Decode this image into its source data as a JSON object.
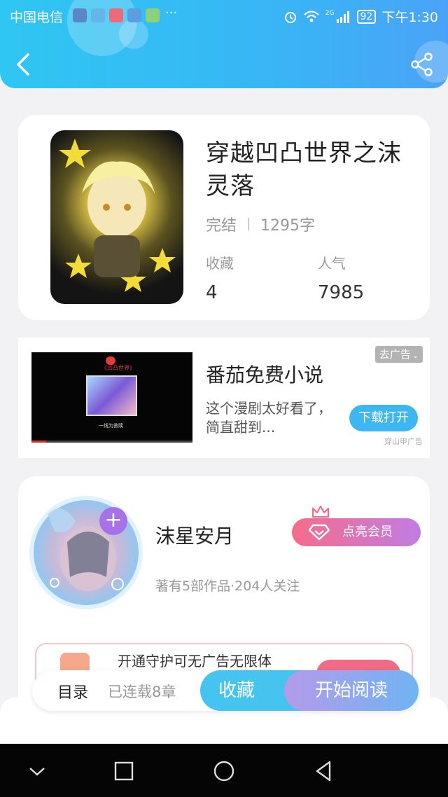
{
  "status_bar": {
    "carrier": "中国电信",
    "more": "···",
    "network": "2G",
    "battery": "92",
    "time": "下午1:30"
  },
  "header": {
    "back_icon": "chevron-left-icon",
    "share_icon": "share-icon"
  },
  "book": {
    "title": "穿越凹凸世界之沫灵落",
    "status": "完结",
    "word_count": "1295字",
    "favorites_label": "收藏",
    "favorites_value": "4",
    "popularity_label": "人气",
    "popularity_value": "7985"
  },
  "ad": {
    "remove_ad": "去广告",
    "title": "番茄免费小说",
    "description": "这个漫剧太好看了，简直甜到...",
    "button": "下载打开",
    "source": "穿山甲广告",
    "video_caption": "《凹凸世界》",
    "video_subtitle": "一线为救赎",
    "progress": 0.09
  },
  "author": {
    "name": "沫星安月",
    "vip_button": "点亮会员",
    "info": "著有5部作品·204人关注",
    "guard_text": "开通守护可无广告无限体"
  },
  "bottom_bar": {
    "toc": "目录",
    "serial_status": "已连载8章",
    "favorite": "收藏",
    "start_reading": "开始阅读"
  },
  "colors": {
    "header_start": "#2fc6f2",
    "header_end": "#4aa3f8",
    "favorite_button": "#44c4ef",
    "vip_gradient_start": "#f66c8a",
    "vip_gradient_end": "#c07de4"
  }
}
